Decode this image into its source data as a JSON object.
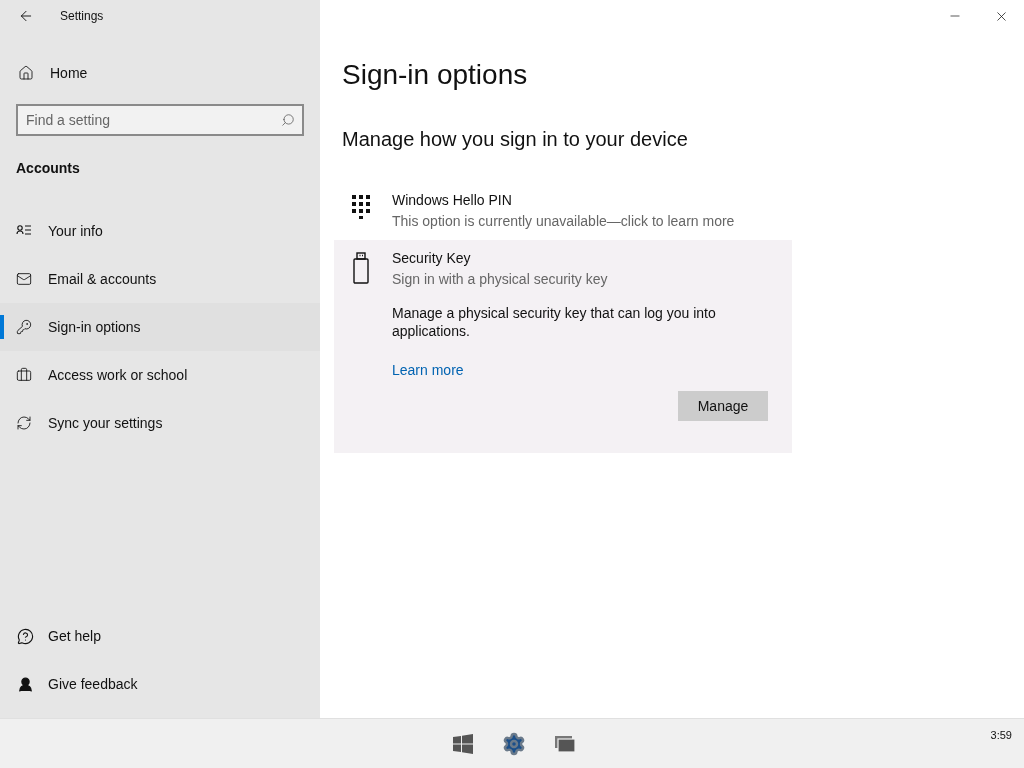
{
  "window": {
    "title": "Settings"
  },
  "sidebar": {
    "home": "Home",
    "search": {
      "placeholder": "Find a setting"
    },
    "section": "Accounts",
    "items": [
      {
        "label": "Your info",
        "selected": false
      },
      {
        "label": "Email & accounts",
        "selected": false
      },
      {
        "label": "Sign-in options",
        "selected": true
      },
      {
        "label": "Access work or school",
        "selected": false
      },
      {
        "label": "Sync your settings",
        "selected": false
      }
    ],
    "footer": [
      "Get help",
      "Give feedback"
    ]
  },
  "page": {
    "title": "Sign-in options",
    "subtitle": "Manage how you sign in to your device",
    "options": [
      {
        "title": "Windows Hello PIN",
        "description": "This option is currently unavailable—click to learn more",
        "expanded": false
      },
      {
        "title": "Security Key",
        "description": "Sign in with a physical security key",
        "expanded": true,
        "details": "Manage a physical security key that can log you into applications.",
        "link": "Learn more",
        "button": "Manage"
      }
    ]
  },
  "taskbar": {
    "clock": "3:59"
  }
}
